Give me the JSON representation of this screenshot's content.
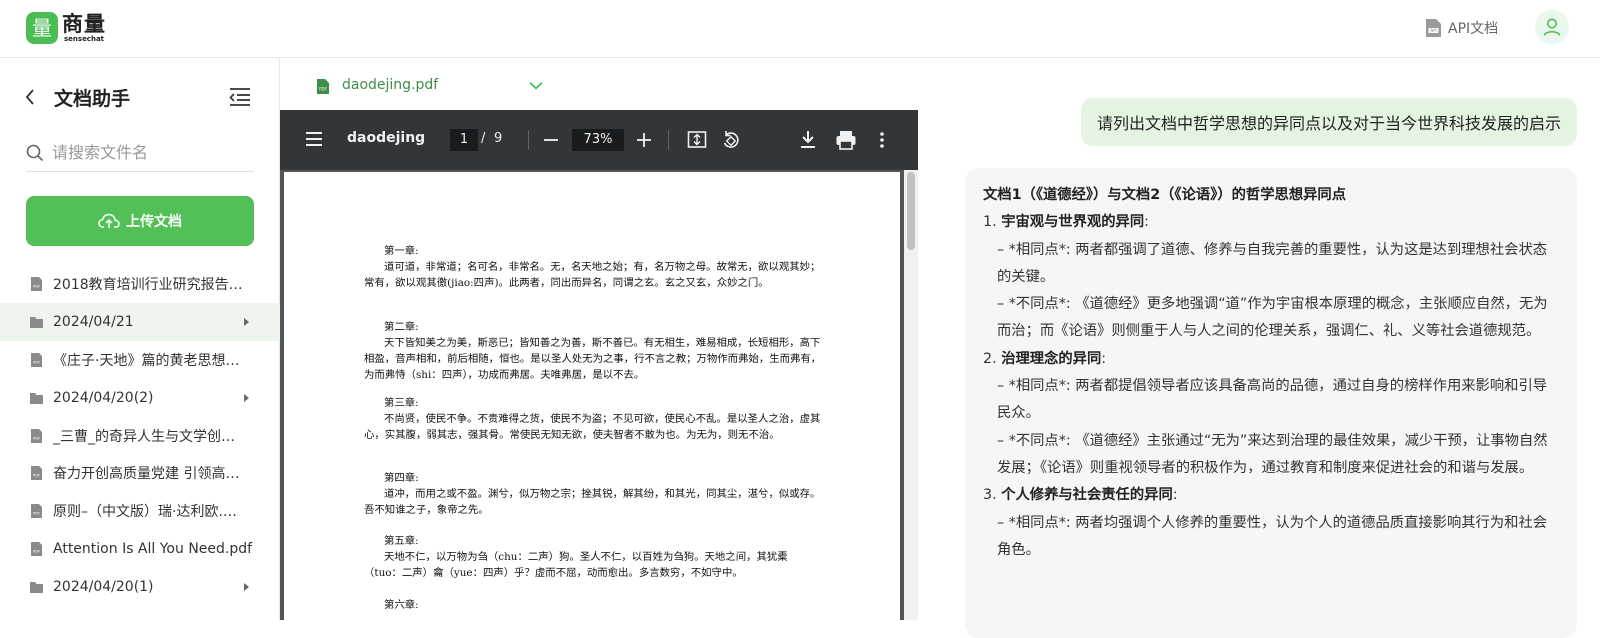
{
  "app": {
    "brand_glyph": "量",
    "brand_name": "商量",
    "brand_sub": "sensechat",
    "api_doc_label": "API文档",
    "accent_color": "#53bf57"
  },
  "sidebar": {
    "title": "文档助手",
    "search_placeholder": "请搜索文件名",
    "upload_label": "上传文档",
    "items": [
      {
        "type": "file",
        "label": "2018教育培训行业研究报告…"
      },
      {
        "type": "folder",
        "label": "2024/04/21",
        "active": true
      },
      {
        "type": "file",
        "label": "《庄子·天地》篇的黄老思想…"
      },
      {
        "type": "folder",
        "label": "2024/04/20(2)"
      },
      {
        "type": "file",
        "label": "_三曹_的奇异人生与文学创…"
      },
      {
        "type": "file",
        "label": "奋力开创高质量党建 引领高…"
      },
      {
        "type": "file",
        "label": "原则–（中文版）瑞·达利欧.…"
      },
      {
        "type": "file",
        "label": "Attention Is All You Need.pdf"
      },
      {
        "type": "folder",
        "label": "2024/04/20(1)"
      }
    ]
  },
  "viewer": {
    "file_name": "daodejing.pdf",
    "doc_title": "daodejing",
    "current_page": "1",
    "slash": "/",
    "total_pages": "9",
    "zoom": "73%",
    "chapters": [
      {
        "heading": "第一章:",
        "body": "道可道，非常道；名可名，非常名。无，名天地之始；有，名万物之母。故常无，欲以观其妙；常有，欲以观其徼(jiao:四声)。此两者，同出而异名，同谓之玄。玄之又玄，众妙之门。"
      },
      {
        "heading": "第二章:",
        "body": "天下皆知美之为美，斯恶已；皆知善之为善，斯不善已。有无相生，难易相成，长短相形，高下相盈，音声相和，前后相随，恒也。是以圣人处无为之事，行不言之教；万物作而弗始，生而弗有，为而弗恃（shi：四声），功成而弗居。夫唯弗居，是以不去。"
      },
      {
        "heading": "第三章:",
        "body": "不尚贤，使民不争。不贵难得之货，使民不为盗；不见可欲，使民心不乱。是以圣人之治，虚其心，实其腹，弱其志，强其骨。常使民无知无欲，使夫智者不敢为也。为无为，则无不治。"
      },
      {
        "heading": "第四章:",
        "body": "道冲，而用之或不盈。渊兮，似万物之宗；挫其锐，解其纷，和其光，同其尘，湛兮，似或存。吾不知谁之子，象帝之先。"
      },
      {
        "heading": "第五章:",
        "body": "天地不仁，以万物为刍（chu：二声）狗。圣人不仁，以百姓为刍狗。天地之间，其犹橐（tuo：二声）龠（yue：四声）乎？虚而不屈，动而愈出。多言数穷，不如守中。"
      },
      {
        "heading": "第六章:",
        "body": ""
      }
    ]
  },
  "chat": {
    "user_message": "请列出文档中哲学思想的异同点以及对于当今世界科技发展的启示",
    "answer_lines": [
      {
        "text": "文档1（《道德经》）与文档2（《论语》）的哲学思想异同点",
        "style": "bold"
      },
      {
        "num": "1. ",
        "head": "宇宙观与世界观的异同",
        "tail": ":"
      },
      {
        "text": "– *相同点*: 两者都强调了道德、修养与自我完善的重要性，认为这是达到理想社会状态的关键。",
        "style": "ind"
      },
      {
        "text": "– *不同点*: 《道德经》更多地强调“道”作为宇宙根本原理的概念，主张顺应自然，无为而治；而《论语》则侧重于人与人之间的伦理关系，强调仁、礼、义等社会道德规范。",
        "style": "ind"
      },
      {
        "num": "2. ",
        "head": "治理理念的异同",
        "tail": ":"
      },
      {
        "text": "– *相同点*: 两者都提倡领导者应该具备高尚的品德，通过自身的榜样作用来影响和引导民众。",
        "style": "ind"
      },
      {
        "text": "– *不同点*: 《道德经》主张通过“无为”来达到治理的最佳效果，减少干预，让事物自然发展；《论语》则重视领导者的积极作为，通过教育和制度来促进社会的和谐与发展。",
        "style": "ind"
      },
      {
        "num": "3. ",
        "head": "个人修养与社会责任的异同",
        "tail": ":"
      },
      {
        "text": "– *相同点*: 两者均强调个人修养的重要性，认为个人的道德品质直接影响其行为和社会角色。",
        "style": "ind"
      }
    ]
  }
}
